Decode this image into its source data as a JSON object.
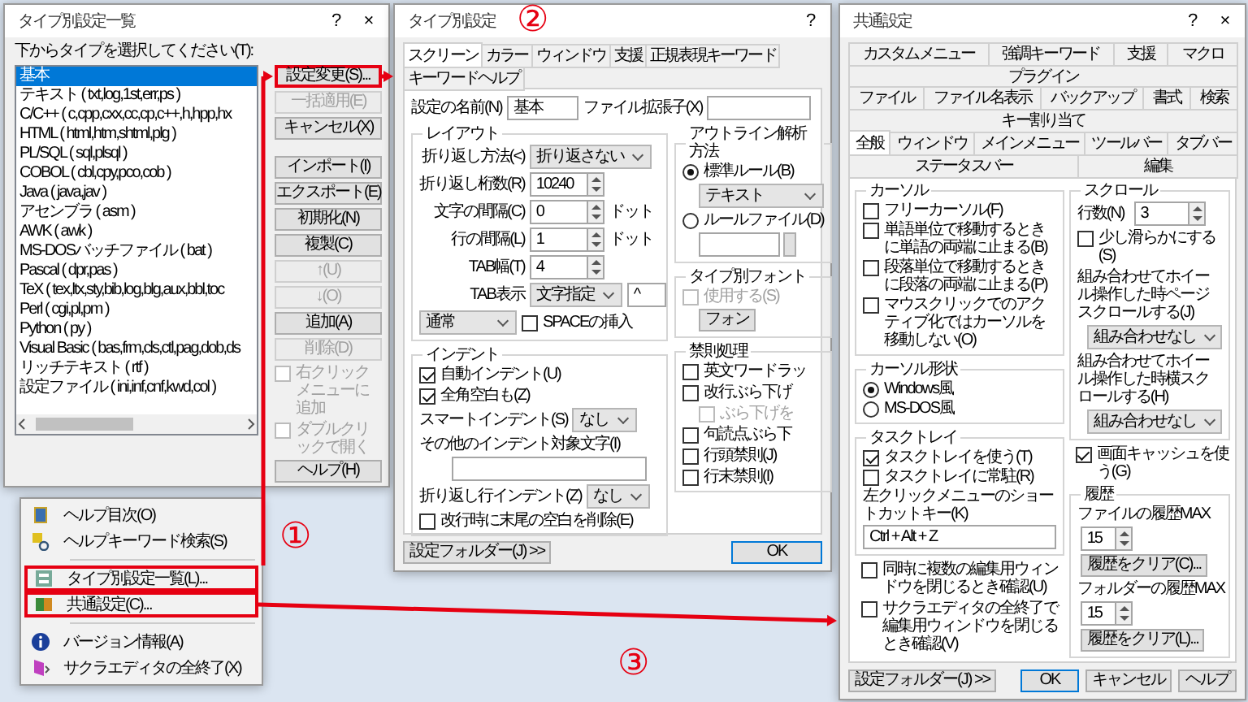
{
  "type_list_dialog": {
    "title": "タイプ別設定一覧",
    "help": "?",
    "close": "×",
    "list_label": "下からタイプを選択してください(T):",
    "types": [
      {
        "label": "基本",
        "selected": true
      },
      {
        "label": "テキスト ( txt,log,1st,err,ps )",
        "selected": false
      },
      {
        "label": "C/C++ ( c,cpp,cxx,cc,cp,c++,h,hpp,hx",
        "selected": false
      },
      {
        "label": "HTML ( html,htm,shtml,plg )",
        "selected": false
      },
      {
        "label": "PL/SQL ( sql,plsql )",
        "selected": false
      },
      {
        "label": "COBOL ( cbl,cpy,pco,cob )",
        "selected": false
      },
      {
        "label": "Java ( java,jav )",
        "selected": false
      },
      {
        "label": "アセンブラ ( asm )",
        "selected": false
      },
      {
        "label": "AWK ( awk )",
        "selected": false
      },
      {
        "label": "MS-DOSバッチファイル ( bat )",
        "selected": false
      },
      {
        "label": "Pascal ( dpr,pas )",
        "selected": false
      },
      {
        "label": "TeX ( tex,ltx,sty,bib,log,blg,aux,bbl,toc",
        "selected": false
      },
      {
        "label": "Perl ( cgi,pl,pm )",
        "selected": false
      },
      {
        "label": "Python ( py )",
        "selected": false
      },
      {
        "label": "Visual Basic ( bas,frm,cls,ctl,pag,dob,ds",
        "selected": false
      },
      {
        "label": "リッチテキスト ( rtf )",
        "selected": false
      },
      {
        "label": "設定ファイル ( ini,inf,cnf,kwd,col )",
        "selected": false
      }
    ],
    "controls": [
      {
        "kind": "button",
        "label": "設定変更(S)...",
        "disabled": false,
        "highlighted": true
      },
      {
        "kind": "button",
        "label": "一括適用(E)",
        "disabled": true,
        "highlighted": false
      },
      {
        "kind": "button",
        "label": "キャンセル(X)",
        "disabled": false,
        "highlighted": false
      },
      {
        "kind": "button",
        "label": "インポート(I)",
        "disabled": false,
        "highlighted": false
      },
      {
        "kind": "button",
        "label": "エクスポート(E)",
        "disabled": false,
        "highlighted": false
      },
      {
        "kind": "button",
        "label": "初期化(N)",
        "disabled": false,
        "highlighted": false
      },
      {
        "kind": "button",
        "label": "複製(C)",
        "disabled": false,
        "highlighted": false
      },
      {
        "kind": "button",
        "label": "↑(U)",
        "disabled": true,
        "highlighted": false
      },
      {
        "kind": "button",
        "label": "↓(O)",
        "disabled": true,
        "highlighted": false
      },
      {
        "kind": "button",
        "label": "追加(A)",
        "disabled": false,
        "highlighted": false
      },
      {
        "kind": "button",
        "label": "削除(D)",
        "disabled": true,
        "highlighted": false
      },
      {
        "kind": "checkbox",
        "label": "右クリックメニューに追加",
        "checked": false,
        "disabled": true
      },
      {
        "kind": "checkbox",
        "label": "ダブルクリックで開く",
        "checked": false,
        "disabled": true
      },
      {
        "kind": "button",
        "label": "ヘルプ(H)",
        "disabled": false,
        "highlighted": false
      }
    ]
  },
  "tray_menu": {
    "items": [
      {
        "kind": "item",
        "label": "ヘルプ目次(O)",
        "highlighted": false
      },
      {
        "kind": "item",
        "label": "ヘルプキーワード検索(S)",
        "highlighted": false
      },
      {
        "kind": "separator"
      },
      {
        "kind": "item",
        "label": "タイプ別設定一覧(L)...",
        "highlighted": true
      },
      {
        "kind": "item",
        "label": "共通設定(C)...",
        "highlighted": true
      },
      {
        "kind": "separator"
      },
      {
        "kind": "item",
        "label": "バージョン情報(A)",
        "highlighted": false
      },
      {
        "kind": "item",
        "label": "サクラエディタの全終了(X)",
        "highlighted": false
      }
    ]
  },
  "type_settings_dialog": {
    "title": "タイプ別設定",
    "help": "?",
    "tabs": [
      {
        "label": "スクリーン",
        "selected": true
      },
      {
        "label": "カラー",
        "selected": false
      },
      {
        "label": "ウィンドウ",
        "selected": false
      },
      {
        "label": "支援",
        "selected": false
      },
      {
        "label": "正規表現キーワード",
        "selected": false
      },
      {
        "label": "キーワードヘルプ",
        "selected": false
      }
    ],
    "name_label": "設定の名前(N)",
    "name_value": "基本",
    "ext_label": "ファイル拡張子(X)",
    "layout": {
      "title": "レイアウト",
      "rows": [
        {
          "kind": "dropdown",
          "label": "折り返し方法(<)",
          "value": "折り返さない"
        },
        {
          "kind": "spin",
          "label": "折り返し桁数(R)",
          "value": "10240"
        },
        {
          "kind": "spin",
          "label": "文字の間隔(C)",
          "value": "0",
          "unit": "ドット"
        },
        {
          "kind": "spin",
          "label": "行の間隔(L)",
          "value": "1",
          "unit": "ドット"
        },
        {
          "kind": "spin",
          "label": "TAB幅(T)",
          "value": "4"
        },
        {
          "kind": "dropdown",
          "label": "TAB表示",
          "value": "文字指定",
          "field": "^"
        },
        {
          "kind": "dropdown",
          "value": "通常",
          "check": {
            "label": "SPACEの挿入",
            "checked": false
          }
        }
      ]
    },
    "outline": {
      "title": "アウトライン解析方法",
      "options": [
        {
          "kind": "radio",
          "label": "標準ルール(B)",
          "selected": true
        },
        {
          "kind": "dropdown",
          "value": "テキスト"
        },
        {
          "kind": "radio",
          "label": "ルールファイル(D)",
          "selected": false
        },
        {
          "kind": "file"
        }
      ]
    },
    "font": {
      "title": "タイプ別フォント",
      "use": {
        "label": "使用する(S)",
        "checked": false,
        "disabled": true
      },
      "button": "フォン"
    },
    "indent": {
      "title": "インデント",
      "checks": [
        {
          "label": "自動インデント(U)",
          "checked": true
        },
        {
          "label": "全角空白も(Z)",
          "checked": true
        }
      ],
      "smart_label": "スマートインデント(S)",
      "smart_value": "なし",
      "other_label": "その他のインデント対象文字(I)",
      "wrap_label": "折り返し行インデント(Z)",
      "wrap_value": "なし",
      "trim": {
        "label": "改行時に末尾の空白を削除(E)",
        "checked": false
      }
    },
    "kinsoku": {
      "title": "禁則処理",
      "items": [
        {
          "label": "英文ワードラッ",
          "checked": false
        },
        {
          "label": "改行ぶら下げ",
          "checked": false,
          "children": [
            {
              "label": "ぶら下げを",
              "checked": false,
              "disabled": true
            }
          ]
        },
        {
          "label": "句読点ぶら下",
          "checked": false
        },
        {
          "label": "行頭禁則(J)",
          "checked": false
        },
        {
          "label": "行末禁則(I)",
          "checked": false
        }
      ]
    },
    "buttons": [
      {
        "label": "設定フォルダー(J) >>",
        "default": false
      },
      {
        "label": "OK",
        "default": true
      }
    ]
  },
  "common_settings_dialog": {
    "title": "共通設定",
    "help": "?",
    "close": "×",
    "tab_rows": [
      [
        {
          "label": "カスタムメニュー",
          "selected": false
        },
        {
          "label": "強調キーワード",
          "selected": false
        },
        {
          "label": "支援",
          "selected": false
        },
        {
          "label": "マクロ",
          "selected": false
        },
        {
          "label": "プラグイン",
          "selected": false
        }
      ],
      [
        {
          "label": "ファイル",
          "selected": false
        },
        {
          "label": "ファイル名表示",
          "selected": false
        },
        {
          "label": "バックアップ",
          "selected": false
        },
        {
          "label": "書式",
          "selected": false
        },
        {
          "label": "検索",
          "selected": false
        },
        {
          "label": "キー割り当て",
          "selected": false
        }
      ],
      [
        {
          "label": "全般",
          "selected": true
        },
        {
          "label": "ウィンドウ",
          "selected": false
        },
        {
          "label": "メインメニュー",
          "selected": false
        },
        {
          "label": "ツールバー",
          "selected": false
        },
        {
          "label": "タブバー",
          "selected": false
        },
        {
          "label": "ステータスバー",
          "selected": false
        },
        {
          "label": "編集",
          "selected": false
        }
      ]
    ],
    "cursor": {
      "title": "カーソル",
      "options": [
        {
          "label": "フリーカーソル(F)",
          "checked": false
        },
        {
          "label": "単語単位で移動するときに単語の両端に止まる(B)",
          "checked": false
        },
        {
          "label": "段落単位で移動するときに段落の両端に止まる(P)",
          "checked": false
        },
        {
          "label": "マウスクリックでのアクティブ化ではカーソルを移動しない(O)",
          "checked": false
        }
      ]
    },
    "cursor_shape": {
      "title": "カーソル形状",
      "options": [
        {
          "label": "Windows風",
          "selected": true
        },
        {
          "label": "MS-DOS風",
          "selected": false
        }
      ]
    },
    "tasktray": {
      "title": "タスクトレイ",
      "options": [
        {
          "label": "タスクトレイを使う(T)",
          "checked": true
        },
        {
          "label": "タスクトレイに常駐(R)",
          "checked": false
        }
      ],
      "shortcut_label": "左クリックメニューのショートカットキー(K)",
      "shortcut_value": "Ctrl + Alt + Z"
    },
    "close_checks": [
      {
        "label": "同時に複数の編集用ウィンドウを閉じるとき確認(U)",
        "checked": false
      },
      {
        "label": "サクラエディタの全終了で編集用ウィンドウを閉じるとき確認(V)",
        "checked": false
      }
    ],
    "scroll": {
      "title": "スクロール",
      "lines_label": "行数(N)",
      "lines_value": "3",
      "smooth": {
        "label": "少し滑らかにする(S)",
        "checked": false
      },
      "page_label": "組み合わせてホイール操作した時ページスクロールする(J)",
      "page_value": "組み合わせなし",
      "horiz_label": "組み合わせてホイール操作した時横スクロールする(H)",
      "horiz_value": "組み合わせなし"
    },
    "cache": {
      "label": "画面キャッシュを使う(G)",
      "checked": true
    },
    "history": {
      "title": "履歴",
      "rows": [
        {
          "label": "ファイルの履歴MAX",
          "value": "15",
          "button": "履歴をクリア(C)..."
        },
        {
          "label": "フォルダーの履歴MAX",
          "value": "15",
          "button": "履歴をクリア(L)..."
        }
      ]
    },
    "buttons": [
      {
        "label": "設定フォルダー(J) >>",
        "default": false
      },
      {
        "label": "OK",
        "default": true
      },
      {
        "label": "キャンセル",
        "default": false
      },
      {
        "label": "ヘルプ",
        "default": false
      }
    ]
  },
  "annotations": [
    {
      "label": "①"
    },
    {
      "label": "②"
    },
    {
      "label": "③"
    }
  ]
}
